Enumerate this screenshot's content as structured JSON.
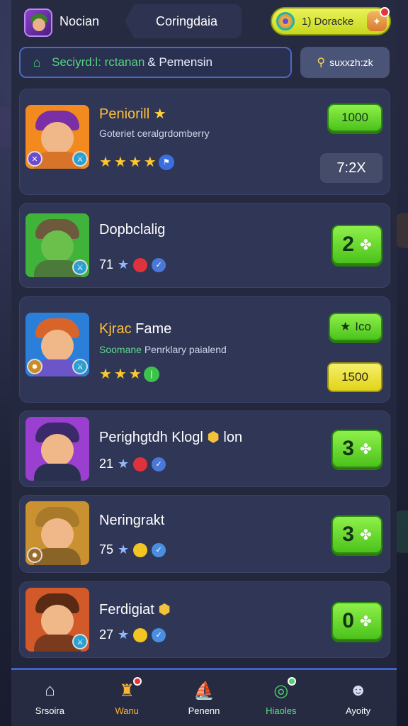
{
  "header": {
    "app_name": "Nocian",
    "active_tab": "Coringdaia",
    "currency_amount": "1) Doracke"
  },
  "search": {
    "placeholder_part1": "Seciyrd:l: rctanan",
    "placeholder_part2": "& Pemensin",
    "sort_label": "suxxzh:zk"
  },
  "cards": [
    {
      "title": "Peniorill",
      "subtitle": "Goteriet ceralgrdomberry",
      "star_count": 4,
      "primary_button": "1000",
      "secondary_button": "7:2X",
      "colors": {
        "avatar_bg": "#f28a1f",
        "hat": "#7a2fa6",
        "body": "#d7742a"
      }
    },
    {
      "title": "Dopbclalig",
      "stat_value": "71",
      "button_number": "2",
      "colors": {
        "avatar_bg": "#3fb33a",
        "hat": "#6d5a3c",
        "body": "#4b7a3a"
      }
    },
    {
      "title_part1": "Kjrac",
      "title_part2": "Fame",
      "subtitle_part1": "Soomane",
      "subtitle_part2": "Penrklary paialend",
      "star_count": 3,
      "primary_button": "Ico",
      "secondary_button": "1500",
      "colors": {
        "avatar_bg": "#2b7fd8",
        "hat": "#d8642a",
        "body": "#6a55c9"
      }
    },
    {
      "title_part1": "Perighgtdh Klogl",
      "title_part2": "lon",
      "stat_value": "21",
      "button_number": "3",
      "colors": {
        "avatar_bg": "#9a3fd0",
        "hat": "#3a2a6a",
        "body": "#2a3050"
      }
    },
    {
      "title": "Neringrakt",
      "stat_value": "75",
      "button_number": "3",
      "colors": {
        "avatar_bg": "#c9912f",
        "hat": "#a97a2a",
        "body": "#8a6326"
      }
    },
    {
      "title": "Ferdigiat",
      "stat_value": "27",
      "button_number": "0",
      "colors": {
        "avatar_bg": "#d25a2a",
        "hat": "#5a2a14",
        "body": "#7a3a1e"
      }
    }
  ],
  "bottom_nav": [
    {
      "label": "Srsoira",
      "icon": "home-icon"
    },
    {
      "label": "Wanu",
      "icon": "trophy-icon"
    },
    {
      "label": "Penenn",
      "icon": "boat-icon"
    },
    {
      "label": "Hiaoles",
      "icon": "compass-icon"
    },
    {
      "label": "Ayoity",
      "icon": "person-icon"
    }
  ]
}
